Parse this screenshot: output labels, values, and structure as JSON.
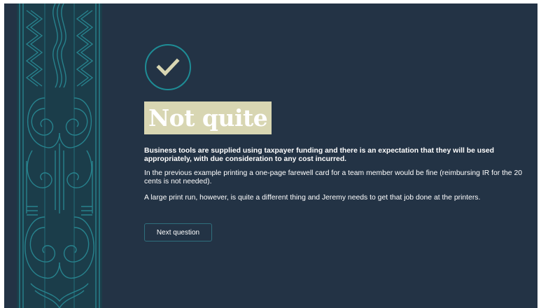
{
  "feedback": {
    "icon": "check-icon",
    "heading": "Not quite",
    "paragraphs": {
      "bold": "Business tools are supplied using taxpayer funding and there is an expectation that they will be used appropriately, with due consideration to any cost incurred.",
      "example": "In the previous example printing a one-page farewell card for a team member would be fine (reimbursing IR for the 20 cents is not needed).",
      "contrast": "A large print run, however, is quite a different thing and Jeremy needs to get that job done at the printers."
    },
    "next_button_label": "Next question"
  },
  "colors": {
    "background": "#233345",
    "pattern_panel": "#1b3d4a",
    "pattern_lines": "#2a8f99",
    "accent_ring": "#1e8c95",
    "check_mark": "#d8d6b2",
    "heading_highlight": "#d8d6b2"
  }
}
